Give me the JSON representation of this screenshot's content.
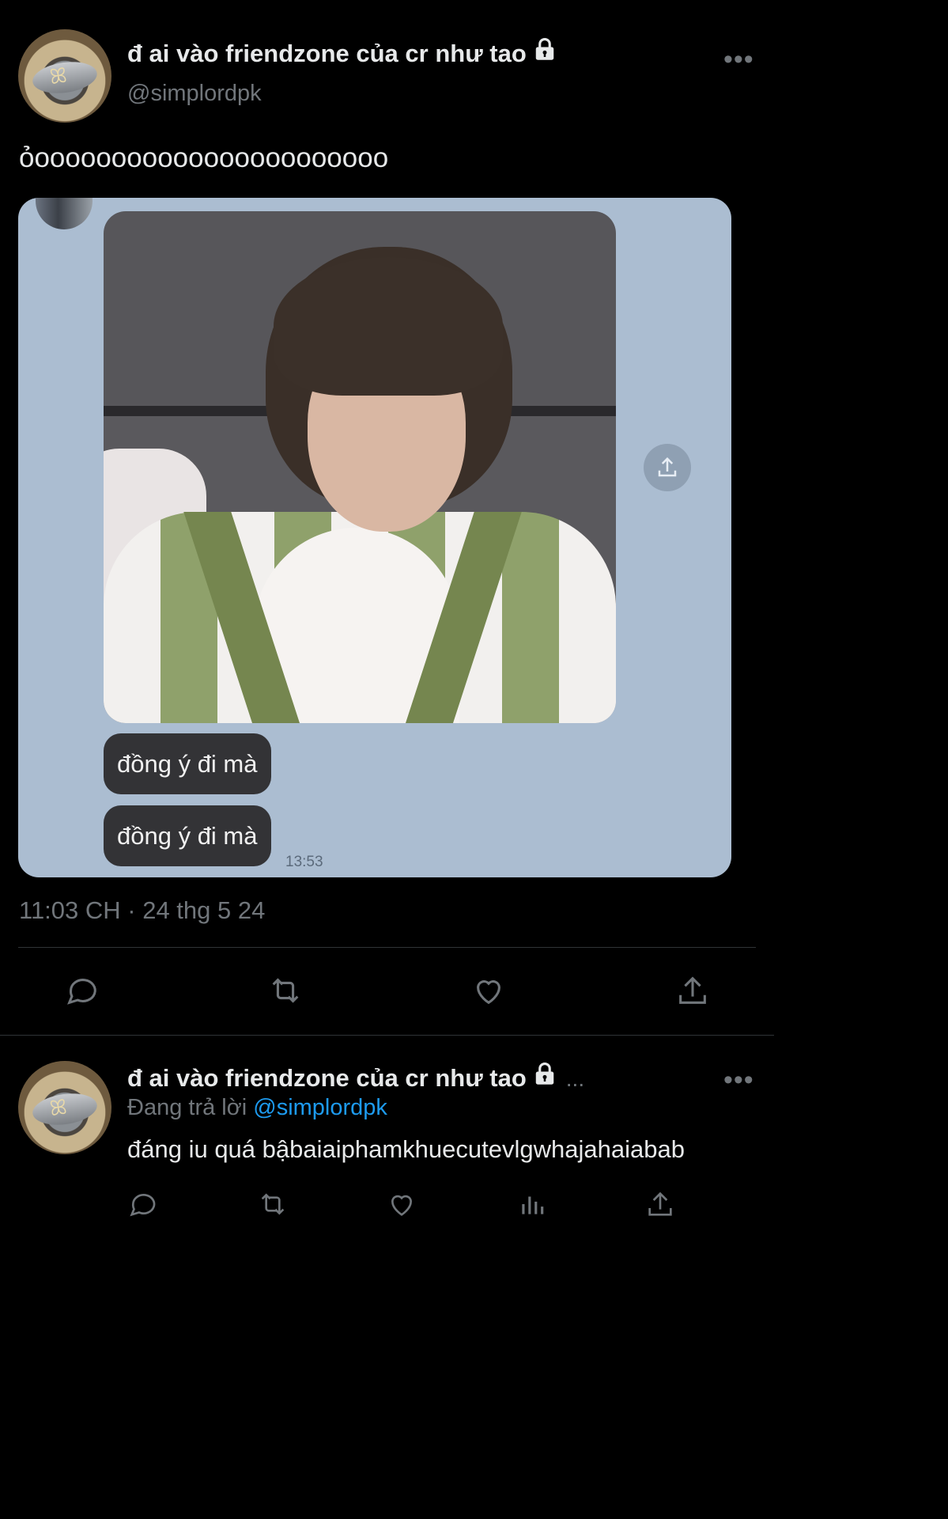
{
  "tweet": {
    "display_name": "đ ai vào friendzone của cr như tao",
    "handle": "@simplordpk",
    "text": "ỏooooooooooooooooooooooo",
    "timestamp": "11:03 CH · 24 thg 5 24",
    "media": {
      "messages": [
        "đồng ý đi mà",
        "đồng ý đi mà"
      ],
      "message_time": "13:53"
    },
    "actions": [
      "reply-icon",
      "retweet-icon",
      "like-icon",
      "share-icon"
    ]
  },
  "reply": {
    "display_name": "đ ai vào friendzone của cr như tao",
    "ellipsis": "...",
    "replying_prefix": "Đang trả lời",
    "replying_to": "@simplordpk",
    "text": "đáng iu quá bậbaiaiphamkhuecutevlgwhajahaiabab",
    "actions": [
      "reply-icon",
      "retweet-icon",
      "like-icon",
      "views-icon",
      "share-icon"
    ]
  },
  "colors": {
    "background": "#000000",
    "text": "#e7e9ea",
    "muted": "#71767b",
    "link": "#1d9bf0",
    "media_background": "#abbdd1",
    "bubble": "#333336"
  }
}
